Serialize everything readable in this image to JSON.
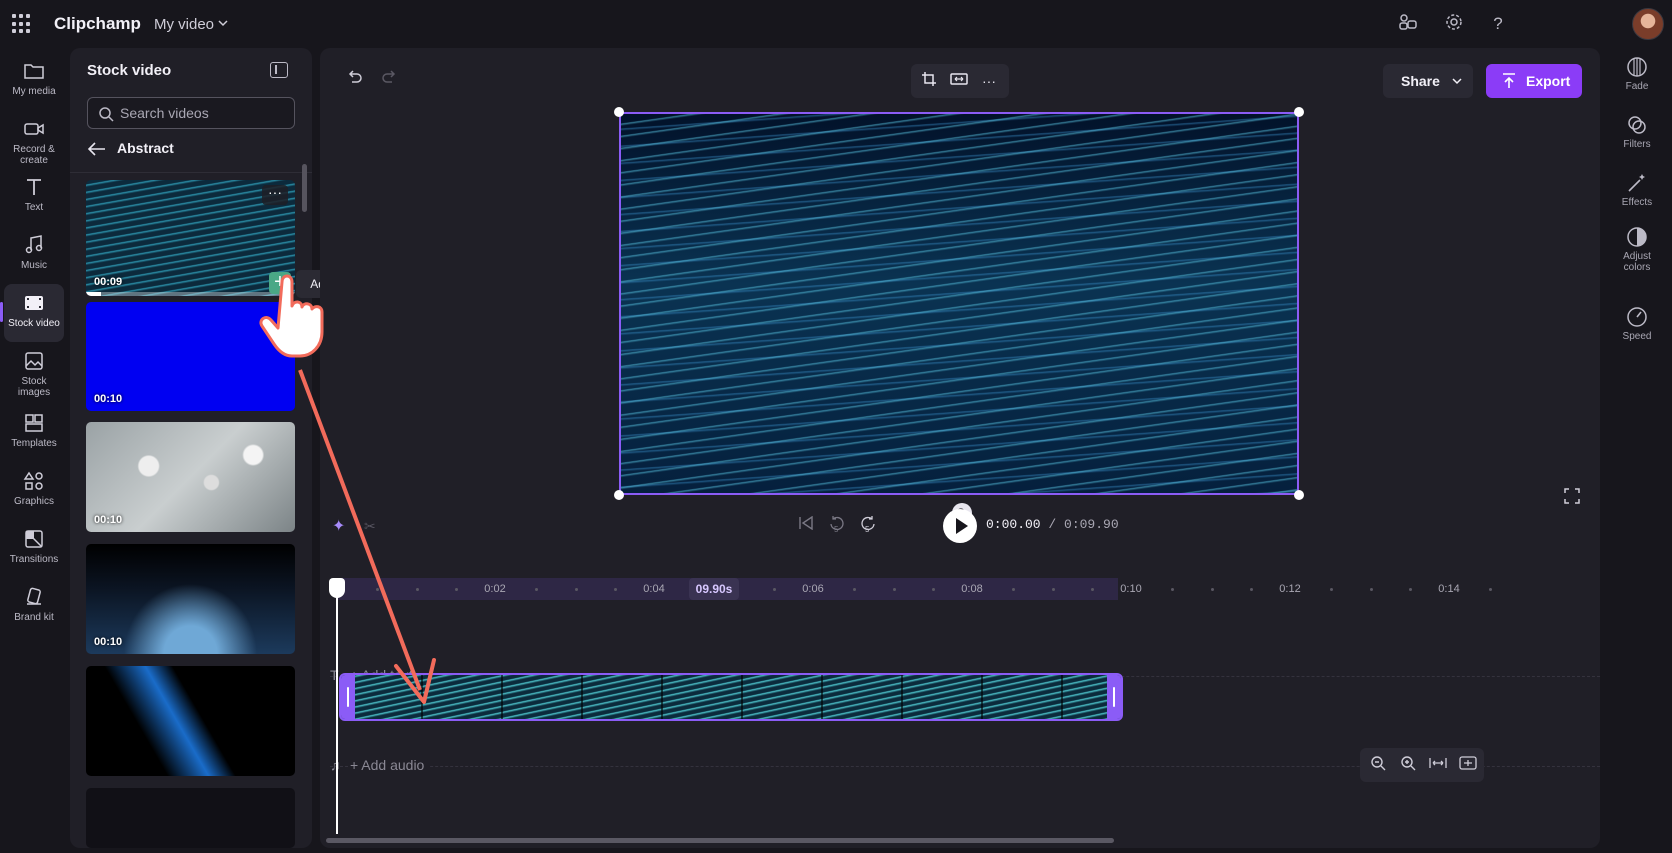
{
  "app": {
    "brand": "Clipchamp",
    "project_name": "My video"
  },
  "left_rail": [
    {
      "label": "My media"
    },
    {
      "label": "Record & create"
    },
    {
      "label": "Text"
    },
    {
      "label": "Music"
    },
    {
      "label": "Stock video"
    },
    {
      "label": "Stock images"
    },
    {
      "label": "Templates"
    },
    {
      "label": "Graphics"
    },
    {
      "label": "Transitions"
    },
    {
      "label": "Brand kit"
    }
  ],
  "panel": {
    "title": "Stock video",
    "search_placeholder": "Search videos",
    "category": "Abstract",
    "thumbnails": [
      {
        "duration": "00:09",
        "progress": 0.07
      },
      {
        "duration": "00:10"
      },
      {
        "duration": "00:10"
      },
      {
        "duration": "00:10"
      },
      {
        "duration": ""
      },
      {
        "duration": ""
      }
    ],
    "tooltip": "Add to timeline"
  },
  "toolbar": {
    "share_label": "Share",
    "export_label": "Export"
  },
  "playback": {
    "current": "0:00.00",
    "total": " / 0:09.90",
    "skip_back_seconds": "5",
    "skip_forward_seconds": "5"
  },
  "ruler": {
    "labels": [
      "0:02",
      "0:04",
      "0:06",
      "0:08",
      "0:10",
      "0:12",
      "0:14"
    ],
    "current_marker": "09.90s"
  },
  "tracks": {
    "text_label": "+ Add text",
    "audio_label": "+ Add audio"
  },
  "right_rail": [
    {
      "label": "Fade"
    },
    {
      "label": "Filters"
    },
    {
      "label": "Effects"
    },
    {
      "label": "Adjust colors"
    },
    {
      "label": "Speed"
    }
  ],
  "colors": {
    "accent": "#8b5cf6",
    "export": "#8b3cf7",
    "annotation": "#f26b5b",
    "add_button": "#4aa886"
  }
}
